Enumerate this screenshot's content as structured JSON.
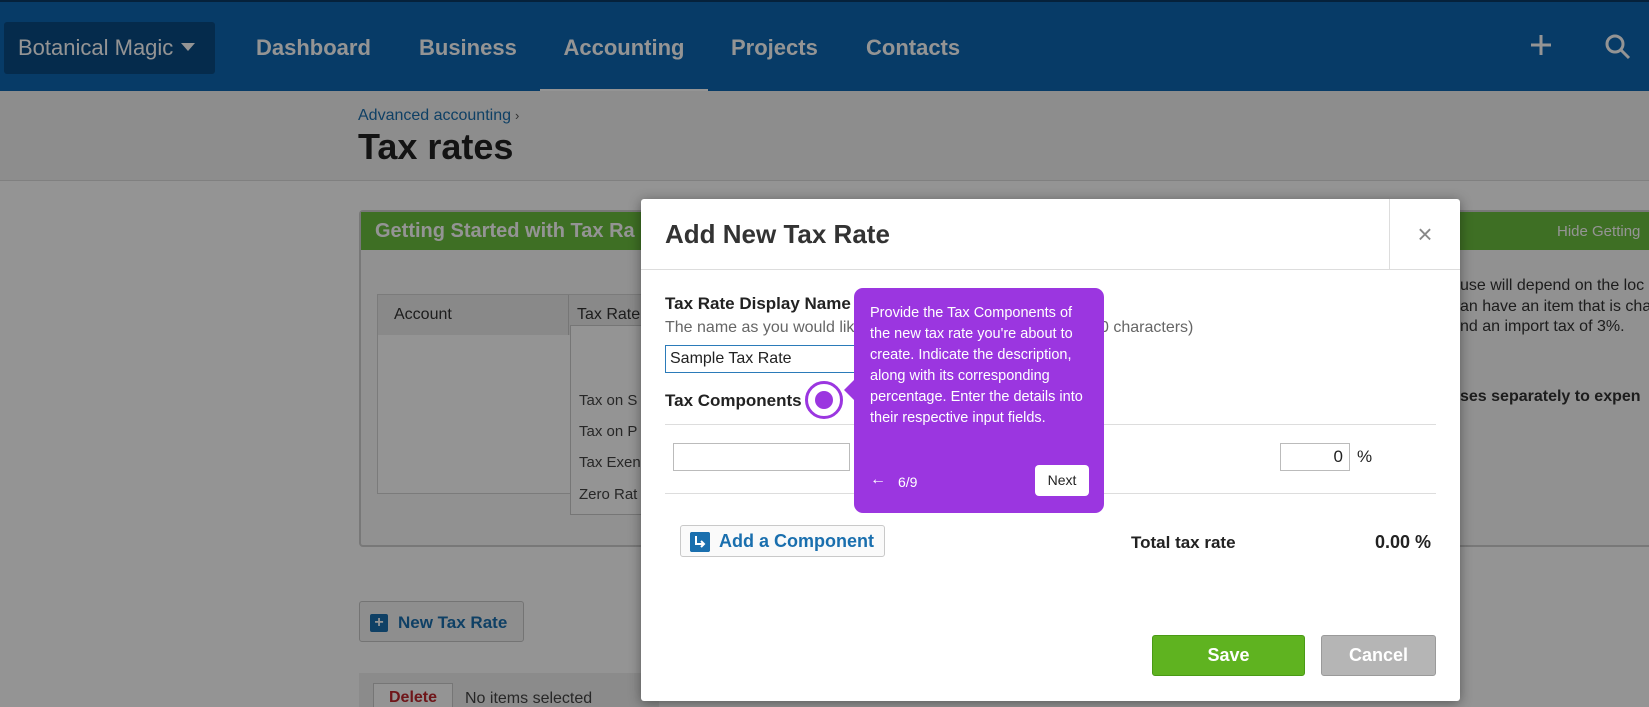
{
  "nav": {
    "org_name": "Botanical Magic",
    "items": [
      "Dashboard",
      "Business",
      "Accounting",
      "Projects",
      "Contacts"
    ],
    "active_item": "Accounting"
  },
  "page": {
    "breadcrumb": "Advanced accounting",
    "breadcrumb_sep": "›",
    "title": "Tax rates"
  },
  "getting_started": {
    "title": "Getting Started with Tax Ra",
    "hide_link": "Hide Getting",
    "table_headers": [
      "Account",
      "Tax Rate"
    ],
    "dropdown_items": [
      "Tax on S",
      "Tax on P",
      "Tax Exen",
      "Zero Rat"
    ],
    "right_text": [
      "use will depend on the loc",
      "an have an item that is cha",
      "nd an import tax of 3%.",
      "ses separately to expen"
    ]
  },
  "page_actions": {
    "new_tax_rate": "New Tax Rate",
    "delete": "Delete",
    "no_items": "No items selected"
  },
  "modal": {
    "title": "Add New Tax Rate",
    "close": "×",
    "display_name_label": "Tax Rate Display Name",
    "display_name_hint": "The name as you would lik",
    "display_name_hint_end": "0 characters)",
    "display_name_value": "Sample Tax Rate",
    "components_label": "Tax Components",
    "component_name_value": "",
    "component_percent_value": "0",
    "percent_sign": "%",
    "add_component": "Add a Component",
    "total_label": "Total tax rate",
    "total_value": "0.00 %",
    "save": "Save",
    "cancel": "Cancel"
  },
  "guide": {
    "text": "Provide the Tax Components of the new tax rate you're about to create. Indicate the description, along with its corresponding percentage. Enter the details into their respective input fields.",
    "back": "←",
    "step": "6/9",
    "next": "Next"
  },
  "colors": {
    "nav_bg": "#0d67b1",
    "guide_purple": "#9b36e0",
    "save_green": "#5fb320",
    "gs_green": "#6cbf3f"
  }
}
